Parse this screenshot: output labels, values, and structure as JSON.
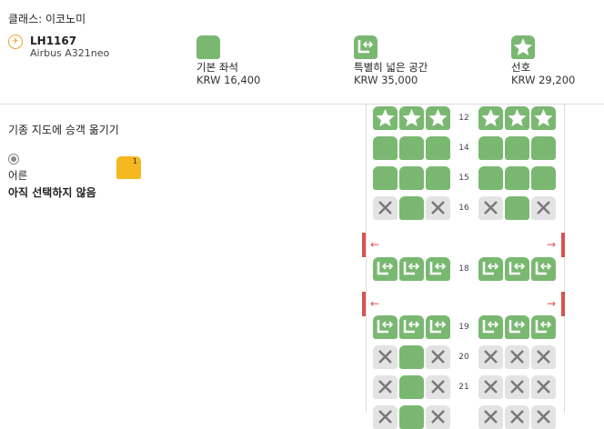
{
  "header": {
    "cabin_title": "클래스: 이코노미",
    "flight_number": "LH1167",
    "aircraft": "Airbus A321neo",
    "airline_icon": "lufthansa-crane-icon"
  },
  "legend": [
    {
      "icon": "seat-icon",
      "label": "기본 좌석",
      "price": "KRW 16,400"
    },
    {
      "icon": "legroom-seat-icon",
      "label": "특별히 넓은 공간",
      "price": "KRW 35,000"
    },
    {
      "icon": "star-seat-icon",
      "label": "선호",
      "price": "KRW 29,200"
    }
  ],
  "move_title": "기종 지도에 승객 옮기기",
  "passenger": {
    "type": "어른",
    "status": "아직 선택하지 않음",
    "badge": "1"
  },
  "rows": [
    {
      "label": "12",
      "left": [
        "star",
        "star",
        "star"
      ],
      "right": [
        "star",
        "star",
        "star"
      ]
    },
    {
      "label": "14",
      "left": [
        "std",
        "std",
        "std"
      ],
      "right": [
        "std",
        "std",
        "std"
      ]
    },
    {
      "label": "15",
      "left": [
        "std",
        "std",
        "std"
      ],
      "right": [
        "std",
        "std",
        "std"
      ]
    },
    {
      "label": "16",
      "left": [
        "na",
        "std",
        "na"
      ],
      "right": [
        "na",
        "std",
        "na"
      ]
    },
    {
      "label": "18",
      "left": [
        "leg",
        "leg",
        "leg"
      ],
      "right": [
        "leg",
        "leg",
        "leg"
      ]
    },
    {
      "label": "19",
      "left": [
        "leg",
        "leg",
        "leg"
      ],
      "right": [
        "leg",
        "leg",
        "leg"
      ]
    },
    {
      "label": "20",
      "left": [
        "na",
        "std",
        "na"
      ],
      "right": [
        "na",
        "na",
        "na"
      ]
    },
    {
      "label": "21",
      "left": [
        "na",
        "std",
        "na"
      ],
      "right": [
        "na",
        "na",
        "na"
      ]
    },
    {
      "label": "",
      "left": [
        "na",
        "std",
        "na"
      ],
      "right": [
        "na",
        "na",
        "na"
      ]
    }
  ],
  "colors": {
    "seat_available": "#7ab872",
    "seat_unavailable": "#e3e3e3",
    "exit": "#d9534f",
    "passenger": "#f6b820"
  }
}
